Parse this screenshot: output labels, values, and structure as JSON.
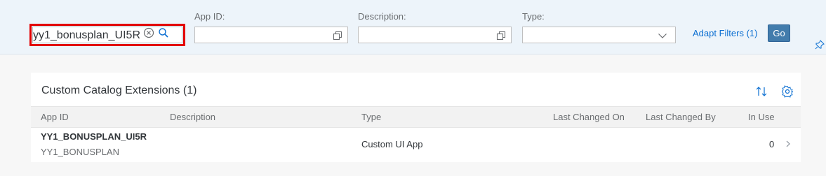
{
  "filters": {
    "search": {
      "value": "yy1_bonusplan_UI5R"
    },
    "app_id": {
      "label": "App ID:",
      "value": ""
    },
    "description": {
      "label": "Description:",
      "value": ""
    },
    "type": {
      "label": "Type:",
      "value": ""
    },
    "adapt_filters": "Adapt Filters (1)",
    "go_label": "Go"
  },
  "table": {
    "title": "Custom Catalog Extensions (1)",
    "columns": [
      "App ID",
      "Description",
      "Type",
      "Last Changed On",
      "Last Changed By",
      "In Use"
    ],
    "rows": [
      {
        "app_id": "YY1_BONUSPLAN_UI5R",
        "app_sub": "YY1_BONUSPLAN",
        "description": "",
        "type": "Custom UI App",
        "last_changed_on": "",
        "last_changed_by": "",
        "in_use": "0"
      }
    ]
  },
  "icons": {
    "search_clear": "clear-circle-icon",
    "search": "search-icon",
    "value_help": "value-help-icon",
    "dropdown": "chevron-down-icon",
    "pin": "pin-icon",
    "sort": "sort-icon",
    "settings": "gear-icon",
    "navigation": "chevron-right-icon"
  },
  "colors": {
    "link": "#0a6ed1",
    "go_button": "#427cac",
    "highlight": "#e30000",
    "filterbar_bg": "#edf4fa"
  }
}
